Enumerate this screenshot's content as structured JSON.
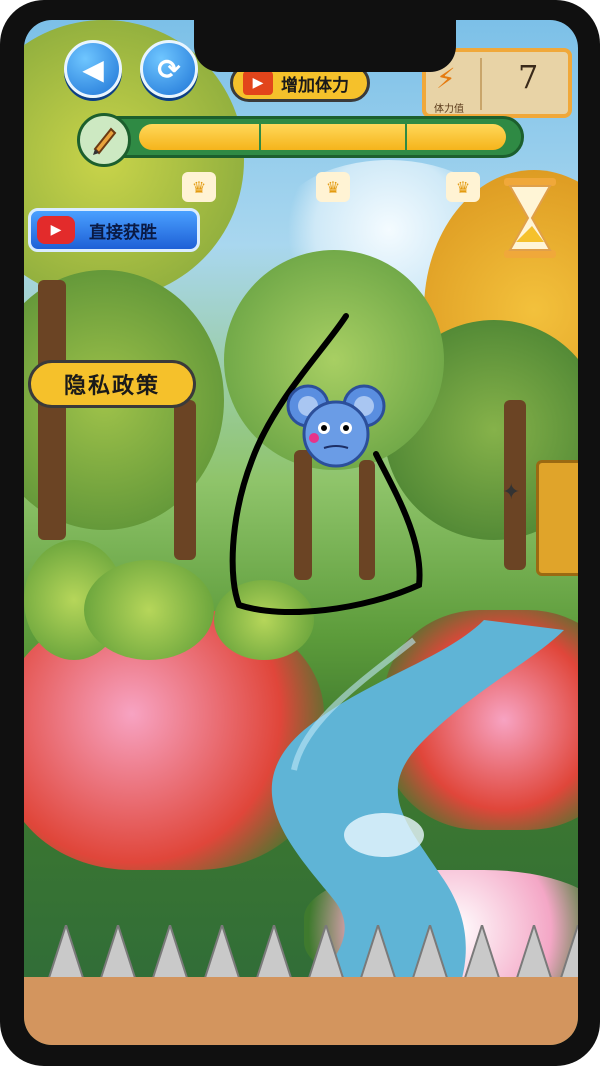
{
  "game": {
    "add_energy_label": "增加体力",
    "direct_win_label": "直接获胜",
    "privacy_label": "隐私政策",
    "energy_caption": "体力值",
    "energy_count": "7",
    "ink_remaining_fraction": 0.98,
    "star_marker": "♛"
  },
  "icons": {
    "back": "back-arrow-icon",
    "restart": "restart-icon",
    "film": "film-icon",
    "lightning": "lightning-icon",
    "video": "video-play-icon",
    "pencil": "pencil-icon",
    "hourglass": "hourglass-icon",
    "crown": "crown-icon",
    "mouse": "mouse-character",
    "beehive": "beehive-icon",
    "spike": "spike-icon"
  },
  "colors": {
    "accent_blue": "#1e74d6",
    "accent_yellow": "#f5c12b",
    "bar_green": "#2f8a44",
    "ground": "#d3955e"
  }
}
